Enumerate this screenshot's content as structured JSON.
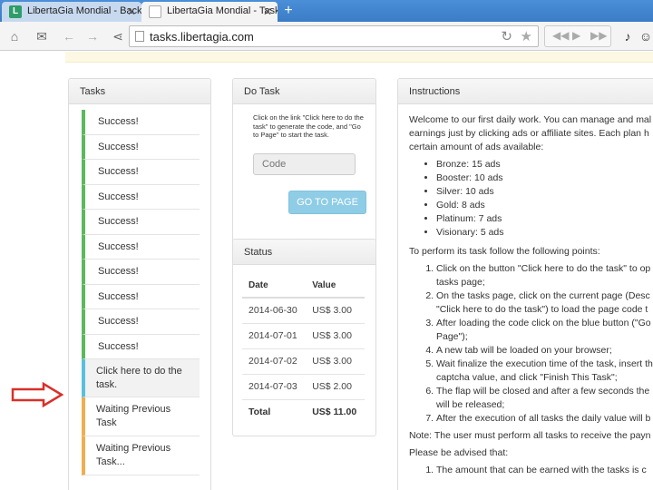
{
  "browser": {
    "tabs": [
      {
        "title": "LibertaGia Mondial - BackOf",
        "favicon": "L",
        "active": false
      },
      {
        "title": "LibertaGia Mondial - Tasks",
        "active": true
      }
    ],
    "new_tab_glyph": "+",
    "url": "tasks.libertagia.com"
  },
  "tasks_panel": {
    "title": "Tasks",
    "items": [
      {
        "label": "Success!",
        "state": "done"
      },
      {
        "label": "Success!",
        "state": "done"
      },
      {
        "label": "Success!",
        "state": "done"
      },
      {
        "label": "Success!",
        "state": "done"
      },
      {
        "label": "Success!",
        "state": "done"
      },
      {
        "label": "Success!",
        "state": "done"
      },
      {
        "label": "Success!",
        "state": "done"
      },
      {
        "label": "Success!",
        "state": "done"
      },
      {
        "label": "Success!",
        "state": "done"
      },
      {
        "label": "Success!",
        "state": "done"
      },
      {
        "label": "Click here to do the task.",
        "state": "current"
      },
      {
        "label": "Waiting Previous Task",
        "state": "waiting"
      },
      {
        "label": "Waiting Previous Task...",
        "state": "waiting"
      }
    ]
  },
  "do_task_panel": {
    "title": "Do Task",
    "description": "Click on the link \"Click here to do the task\" to generate the code, and \"Go to Page\" to start the task.",
    "code_placeholder": "Code",
    "goto_label": "GO TO PAGE"
  },
  "status_panel": {
    "title": "Status",
    "columns": [
      "Date",
      "Value"
    ],
    "rows": [
      {
        "date": "2014-06-30",
        "value": "US$ 3.00"
      },
      {
        "date": "2014-07-01",
        "value": "US$ 3.00"
      },
      {
        "date": "2014-07-02",
        "value": "US$ 3.00"
      },
      {
        "date": "2014-07-03",
        "value": "US$ 2.00"
      }
    ],
    "total_label": "Total",
    "total_value": "US$ 11.00"
  },
  "instructions_panel": {
    "title": "Instructions",
    "intro_lines": [
      "Welcome to our first daily work. You can manage and mal",
      "earnings just by clicking ads or affiliate sites. Each plan h",
      "certain amount of ads available:"
    ],
    "plans": [
      "Bronze: 15 ads",
      "Booster: 10 ads",
      "Silver: 10 ads",
      "Gold: 8 ads",
      "Platinum: 7 ads",
      "Visionary: 5 ads"
    ],
    "steps_intro": "To perform its task follow the following points:",
    "steps": [
      [
        "Click on the button \"Click here to do the task\" to op",
        "tasks page;"
      ],
      [
        "On the tasks page, click on the current page (Desc",
        "\"Click here to do the task\") to load the page code t"
      ],
      [
        "After loading the code click on the blue button (\"Go",
        "Page\");"
      ],
      [
        "A new tab will be loaded on your browser;"
      ],
      [
        "Wait finalize the execution time of the task, insert th",
        "captcha value, and click \"Finish This Task\";"
      ],
      [
        "The flap will be closed and after a few seconds the",
        "will be released;"
      ],
      [
        "After the execution of all tasks the daily value will b"
      ]
    ],
    "note": "Note: The user must perform all tasks to receive the payn",
    "advised": "Please be advised that:",
    "final_item": "The amount that can be earned with the tasks is c"
  },
  "colors": {
    "success": "#5cb85c",
    "current": "#5bc0de",
    "waiting": "#f0ad4e",
    "arrow": "#d9302a"
  },
  "icons": [
    "home-icon",
    "mail-icon",
    "back-icon",
    "forward-icon",
    "share-icon",
    "reload-icon",
    "star-icon",
    "music-icon",
    "cursor-arrow-icon"
  ]
}
